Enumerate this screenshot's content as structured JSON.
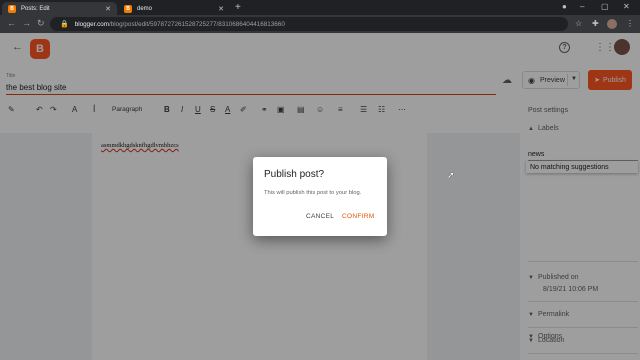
{
  "browser": {
    "tabs": [
      {
        "title": "Posts: Edit",
        "active": true
      },
      {
        "title": "demo",
        "active": false
      }
    ],
    "new_tab": "+",
    "url_host": "blogger.com",
    "url_path": "/blog/post/edit/5978727261528725277/8310686404416813660"
  },
  "app": {
    "back": "←",
    "logo_letter": "B",
    "title_label": "Title",
    "title_value": "the best blog site",
    "preview_label": "Preview",
    "publish_label": "Publish",
    "paragraph_style": "Paragraph",
    "doc_text": "asmmdkhgdsknfhgdlvmbhzcs"
  },
  "sidebar": {
    "title": "Post settings",
    "labels_header": "Labels",
    "labels_input": "news",
    "suggestion": "No matching suggestions",
    "published_header": "Published on",
    "published_date": "8/19/21 10:06 PM",
    "permalink": "Permalink",
    "location": "Location",
    "options": "Options"
  },
  "dialog": {
    "title": "Publish post?",
    "body": "This will publish this post to your blog.",
    "cancel": "CANCEL",
    "confirm": "CONFIRM"
  },
  "colors": {
    "accent": "#ff5722",
    "confirm": "#e65100"
  }
}
